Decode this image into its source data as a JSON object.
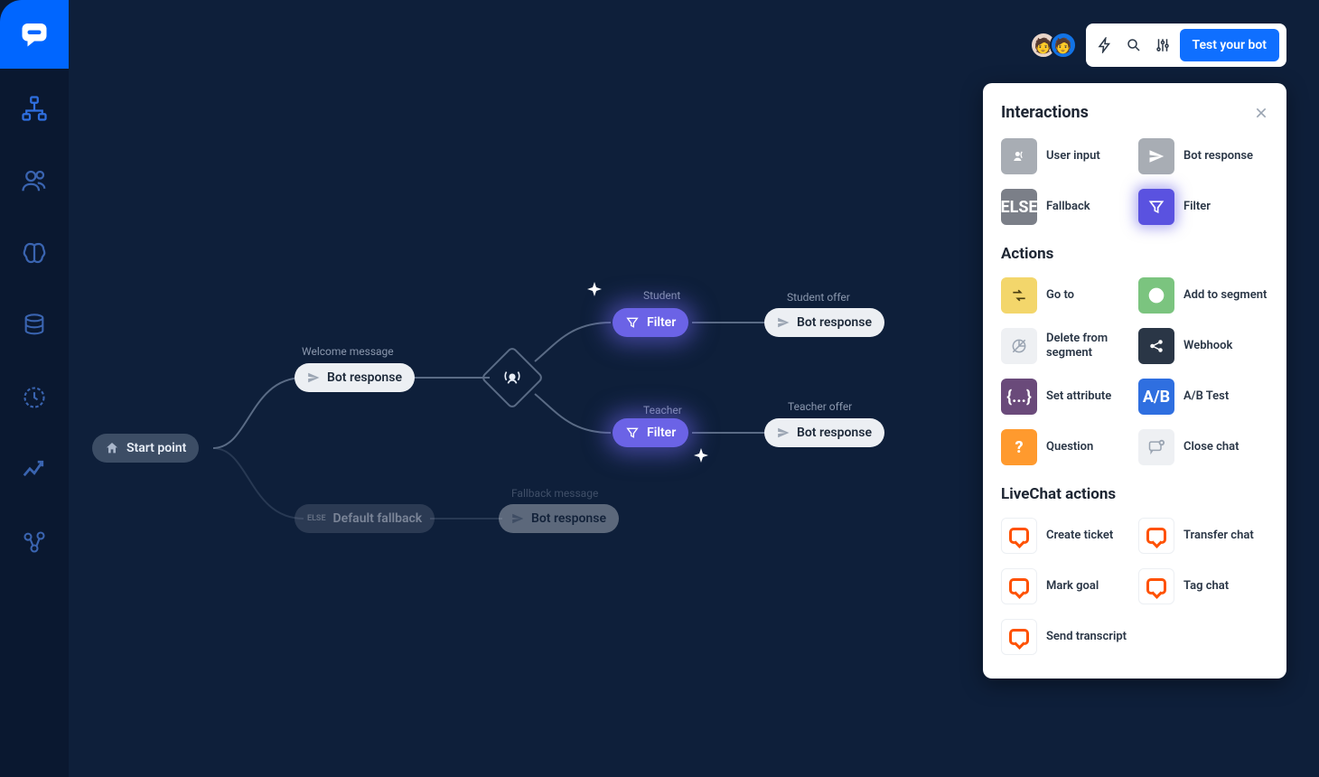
{
  "topbar": {
    "test_button": "Test your bot"
  },
  "panel": {
    "title": "Interactions",
    "sections": {
      "interactions_title": "Interactions",
      "actions_title": "Actions",
      "livechat_title": "LiveChat actions"
    },
    "interactions": {
      "user_input": "User input",
      "bot_response": "Bot response",
      "fallback": "Fallback",
      "filter": "Filter"
    },
    "actions": {
      "go_to": "Go to",
      "add_segment": "Add to segment",
      "delete_segment": "Delete from segment",
      "webhook": "Webhook",
      "set_attribute": "Set attribute",
      "ab_test": "A/B Test",
      "question": "Question",
      "close_chat": "Close chat"
    },
    "livechat": {
      "create_ticket": "Create ticket",
      "transfer_chat": "Transfer chat",
      "mark_goal": "Mark goal",
      "tag_chat": "Tag chat",
      "send_transcript": "Send transcript"
    }
  },
  "flow": {
    "start": "Start point",
    "welcome_label": "Welcome message",
    "welcome_node": "Bot response",
    "student_label": "Student",
    "student_node": "Filter",
    "student_offer_label": "Student offer",
    "student_offer_node": "Bot response",
    "teacher_label": "Teacher",
    "teacher_node": "Filter",
    "teacher_offer_label": "Teacher offer",
    "teacher_offer_node": "Bot response",
    "fallback_label": "Fallback message",
    "fallback_node": "Bot response",
    "default_fallback": "Default fallback"
  },
  "else_tile": "ELSE",
  "attr_tile": "{...}",
  "ab_tile": "A/B",
  "q_tile": "?"
}
